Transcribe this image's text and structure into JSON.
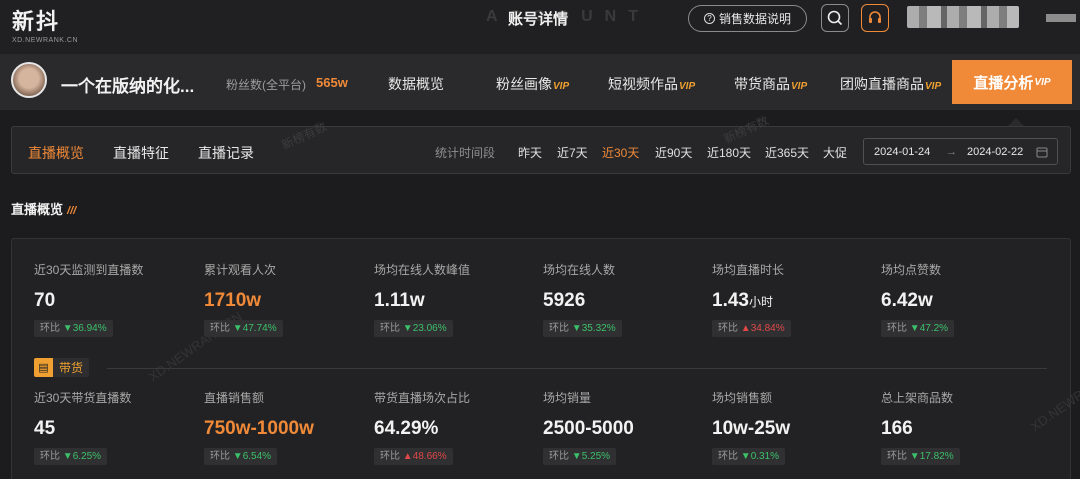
{
  "header": {
    "logo": "新抖",
    "logo_sub": "XD.NEWRANK.CN",
    "bg_word": "ACCOUNT",
    "page_title": "账号详情",
    "help_button": "销售数据说明"
  },
  "account": {
    "name": "一个在版纳的化...",
    "fans_label": "粉丝数(全平台)",
    "fans_value": "565w",
    "tabs": [
      {
        "label": "数据概览",
        "vip": ""
      },
      {
        "label": "粉丝画像",
        "vip": "VIP"
      },
      {
        "label": "短视频作品",
        "vip": "VIP"
      },
      {
        "label": "带货商品",
        "vip": "VIP"
      },
      {
        "label": "团购直播商品",
        "vip": "VIP"
      },
      {
        "label": "直播分析",
        "vip": "VIP"
      }
    ]
  },
  "subnav": {
    "tabs": [
      "直播概览",
      "直播特征",
      "直播记录"
    ],
    "period_label": "统计时间段",
    "periods": [
      "昨天",
      "近7天",
      "近30天",
      "近90天",
      "近180天",
      "近365天",
      "大促"
    ],
    "date_start": "2024-01-24",
    "date_arrow": "→",
    "date_end": "2024-02-22",
    "watermark": "新榜有数"
  },
  "section": {
    "title": "直播概览",
    "badge": "带货",
    "watermark": "XD.NEWRANK.CN"
  },
  "stats_row1": [
    {
      "label": "近30天监测到直播数",
      "value": "70",
      "unit": "",
      "change_label": "环比",
      "dir": "down",
      "change": "36.94%"
    },
    {
      "label": "累计观看人次",
      "value": "1710w",
      "unit": "",
      "change_label": "环比",
      "dir": "down",
      "change": "47.74%"
    },
    {
      "label": "场均在线人数峰值",
      "value": "1.11w",
      "unit": "",
      "change_label": "环比",
      "dir": "down",
      "change": "23.06%"
    },
    {
      "label": "场均在线人数",
      "value": "5926",
      "unit": "",
      "change_label": "环比",
      "dir": "down",
      "change": "35.32%"
    },
    {
      "label": "场均直播时长",
      "value": "1.43",
      "unit": "小时",
      "change_label": "环比",
      "dir": "up",
      "change": "34.84%"
    },
    {
      "label": "场均点赞数",
      "value": "6.42w",
      "unit": "",
      "change_label": "环比",
      "dir": "down",
      "change": "47.2%"
    }
  ],
  "stats_row2": [
    {
      "label": "近30天带货直播数",
      "value": "45",
      "unit": "",
      "change_label": "环比",
      "dir": "down",
      "change": "6.25%"
    },
    {
      "label": "直播销售额",
      "value": "750w-1000w",
      "unit": "",
      "change_label": "环比",
      "dir": "down",
      "change": "6.54%"
    },
    {
      "label": "带货直播场次占比",
      "value": "64.29%",
      "unit": "",
      "change_label": "环比",
      "dir": "up",
      "change": "48.66%"
    },
    {
      "label": "场均销量",
      "value": "2500-5000",
      "unit": "",
      "change_label": "环比",
      "dir": "down",
      "change": "5.25%"
    },
    {
      "label": "场均销售额",
      "value": "10w-25w",
      "unit": "",
      "change_label": "环比",
      "dir": "down",
      "change": "0.31%"
    },
    {
      "label": "总上架商品数",
      "value": "166",
      "unit": "",
      "change_label": "环比",
      "dir": "down",
      "change": "17.82%"
    }
  ],
  "colors": {
    "accent": "#f08a38",
    "up": "#e04848",
    "down": "#3cc06a",
    "vip": "#f0a030"
  },
  "icons": {
    "help": "question-circle-icon",
    "search": "search-icon",
    "support": "headset-icon",
    "calendar": "calendar-icon",
    "cart": "cart-icon"
  }
}
